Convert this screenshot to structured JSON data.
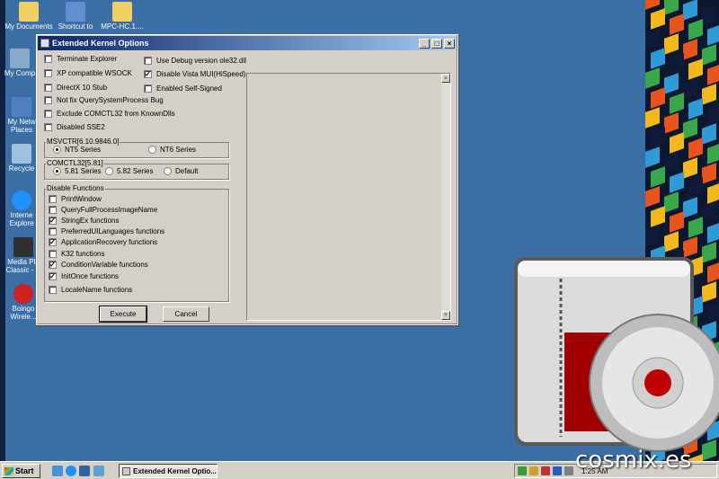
{
  "desktop": {
    "icons": [
      {
        "label": "My Documents",
        "color": "#f0d060"
      },
      {
        "label": "Shortcut to",
        "color": "#6090d0"
      },
      {
        "label": "MPC-HC.1....",
        "color": "#f0d060"
      },
      {
        "label": "My Comp",
        "color": "#8aa8c8"
      },
      {
        "label": "My Netw",
        "label2": "Places",
        "color": "#5080c0"
      },
      {
        "label": "Recycle",
        "color": "#a0c0e0"
      },
      {
        "label": "Interne",
        "label2": "Explore",
        "color": "#1e90ff"
      },
      {
        "label": "Media Pla",
        "label2": "Classic - H",
        "color": "#303030"
      },
      {
        "label": "Boingo",
        "label2": "Wirele...",
        "color": "#d02020"
      }
    ]
  },
  "window": {
    "title": "Extended Kernel Options",
    "controls": {
      "minimize": "_",
      "maximize": "□",
      "close": "×"
    },
    "left_options": [
      {
        "label": "Terminate Explorer",
        "checked": false
      },
      {
        "label": "XP compatible WSOCK",
        "checked": false
      },
      {
        "label": "DirectX 10 Stub",
        "checked": false
      },
      {
        "label": "Not fix QuerySystemProcess Bug",
        "checked": false
      },
      {
        "label": "Exclude COMCTL32 from KnownDlls",
        "checked": false
      },
      {
        "label": "Disabled SSE2",
        "checked": false
      }
    ],
    "right_options": [
      {
        "label": "Use Debug version ole32.dll",
        "checked": false
      },
      {
        "label": "Disable Vista MUI(HiSpeed)",
        "checked": true
      },
      {
        "label": "Enabled Self-Signed",
        "checked": false
      }
    ],
    "msvcrt": {
      "legend": "MSVCTR[6.10.9846.0]",
      "options": [
        {
          "label": "NT5 Series",
          "selected": true
        },
        {
          "label": "NT6 Series",
          "selected": false
        }
      ]
    },
    "comctl32": {
      "legend": "COMCTL32[5.81]",
      "options": [
        {
          "label": "5.81 Series",
          "selected": true
        },
        {
          "label": "5.82 Series",
          "selected": false
        },
        {
          "label": "Default",
          "selected": false
        }
      ]
    },
    "disable_functions": {
      "legend": "Disable Functions",
      "items": [
        {
          "label": "PrintWindow",
          "checked": false
        },
        {
          "label": "QueryFullProcessImageName",
          "checked": false
        },
        {
          "label": "StringEx functions",
          "checked": true
        },
        {
          "label": "PreferredUILanguages functions",
          "checked": false
        },
        {
          "label": "ApplicationRecovery functions",
          "checked": true
        },
        {
          "label": "K32 functions",
          "checked": false
        },
        {
          "label": "ConditionVariable functions",
          "checked": true
        },
        {
          "label": "InitOnce functions",
          "checked": true
        },
        {
          "label": "LocaleName functions",
          "checked": false
        }
      ]
    },
    "execute_label": "Execute",
    "cancel_label": "Cancel"
  },
  "taskbar": {
    "start_label": "Start",
    "task_label": "Extended Kernel Optio...",
    "clock": "1:25 AM"
  },
  "watermark": "cosmix.es",
  "colors": {
    "desktop": "#3a6ea5",
    "title_start": "#0a246a",
    "title_end": "#a6caf0",
    "dialog": "#d4d0c8"
  }
}
